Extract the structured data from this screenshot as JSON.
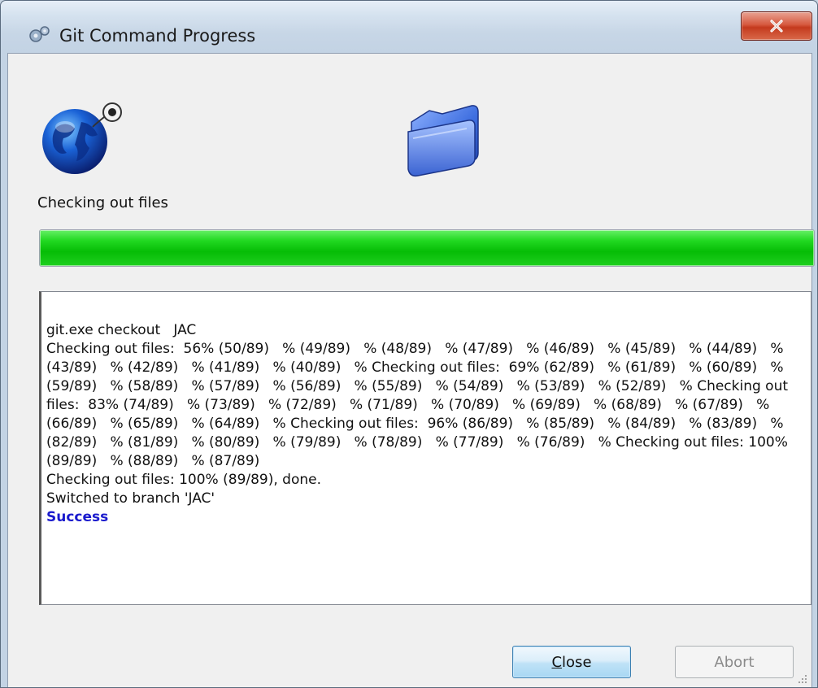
{
  "window": {
    "title": "Git Command Progress",
    "title_icon": "gears-icon",
    "close_icon": "close-x-icon"
  },
  "status": {
    "text": "Checking out files",
    "progress_percent": 100,
    "progress_color": "#06bd06"
  },
  "log": {
    "lines": [
      "git.exe checkout   JAC",
      "Checking out files:  56% (50/89)   % (49/89)   % (48/89)   % (47/89)   % (46/89)   % (45/89)   % (44/89)   % (43/89)   % (42/89)   % (41/89)   % (40/89)   % Checking out files:  69% (62/89)   % (61/89)   % (60/89)   % (59/89)   % (58/89)   % (57/89)   % (56/89)   % (55/89)   % (54/89)   % (53/89)   % (52/89)   % Checking out files:  83% (74/89)   % (73/89)   % (72/89)   % (71/89)   % (70/89)   % (69/89)   % (68/89)   % (67/89)   % (66/89)   % (65/89)   % (64/89)   % Checking out files:  96% (86/89)   % (85/89)   % (84/89)   % (83/89)   % (82/89)   % (81/89)   % (80/89)   % (79/89)   % (78/89)   % (77/89)   % (76/89)   % Checking out files: 100% (89/89)   % (88/89)   % (87/89)",
      "Checking out files: 100% (89/89), done.",
      "Switched to branch 'JAC'"
    ],
    "success_text": "Success",
    "success_color": "#1a1acd"
  },
  "buttons": {
    "close_label": "Close",
    "close_mnemonic": "C",
    "close_rest": "lose",
    "abort_label": "Abort",
    "abort_enabled": false
  },
  "icons": {
    "globe": "globe-icon",
    "folder": "folder-icon",
    "grip": "resize-grip-icon"
  }
}
